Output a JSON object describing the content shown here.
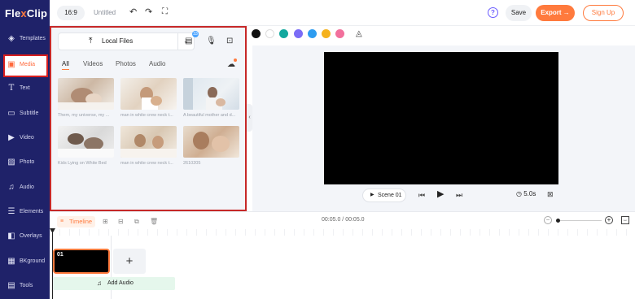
{
  "brand": {
    "logo_part1": "Fle",
    "logo_x": "x",
    "logo_part2": "Clip"
  },
  "sidebar": {
    "items": [
      {
        "label": "Templates",
        "icon": "layers-icon"
      },
      {
        "label": "Media",
        "icon": "folder-icon",
        "active": true
      },
      {
        "label": "Text",
        "icon": "text-icon"
      },
      {
        "label": "Subtitle",
        "icon": "subtitle-icon"
      },
      {
        "label": "Video",
        "icon": "video-icon"
      },
      {
        "label": "Photo",
        "icon": "photo-icon"
      },
      {
        "label": "Audio",
        "icon": "music-icon"
      },
      {
        "label": "Elements",
        "icon": "elements-icon"
      },
      {
        "label": "Overlays",
        "icon": "overlays-icon"
      },
      {
        "label": "BKground",
        "icon": "background-icon"
      },
      {
        "label": "Tools",
        "icon": "tools-icon"
      }
    ]
  },
  "topbar": {
    "ratio": "16:9",
    "title": "Untitled",
    "save": "Save",
    "export": "Export",
    "export_arrow": "→",
    "signup": "Sign Up",
    "help": "?"
  },
  "media_panel": {
    "local_files": "Local Files",
    "badge_count": "33",
    "tabs": [
      "All",
      "Videos",
      "Photos",
      "Audio"
    ],
    "active_tab": "All",
    "thumbnails": [
      {
        "caption": "Them, my universe, my ..."
      },
      {
        "caption": "man in white crew neck t..."
      },
      {
        "caption": "A beautiful mother and d..."
      },
      {
        "caption": "Kids Lying on White Bed"
      },
      {
        "caption": "man in white crew neck t..."
      },
      {
        "caption": "2610205"
      }
    ]
  },
  "colors": {
    "swatches": [
      "#111111",
      "#ffffff",
      "#13a89e",
      "#7b6cf6",
      "#2d9cf0",
      "#f5b21d",
      "#f2709c"
    ],
    "accent": "#ff7a3d",
    "sidebar_bg": "#1f2269"
  },
  "preview": {
    "scene_label": "Scene  01",
    "duration": "5.0s"
  },
  "timeline": {
    "label": "Timeline",
    "time": "00:05.0 / 00:05.0",
    "clip_number": "01",
    "add_audio": "Add Audio",
    "add_scene": "+"
  }
}
